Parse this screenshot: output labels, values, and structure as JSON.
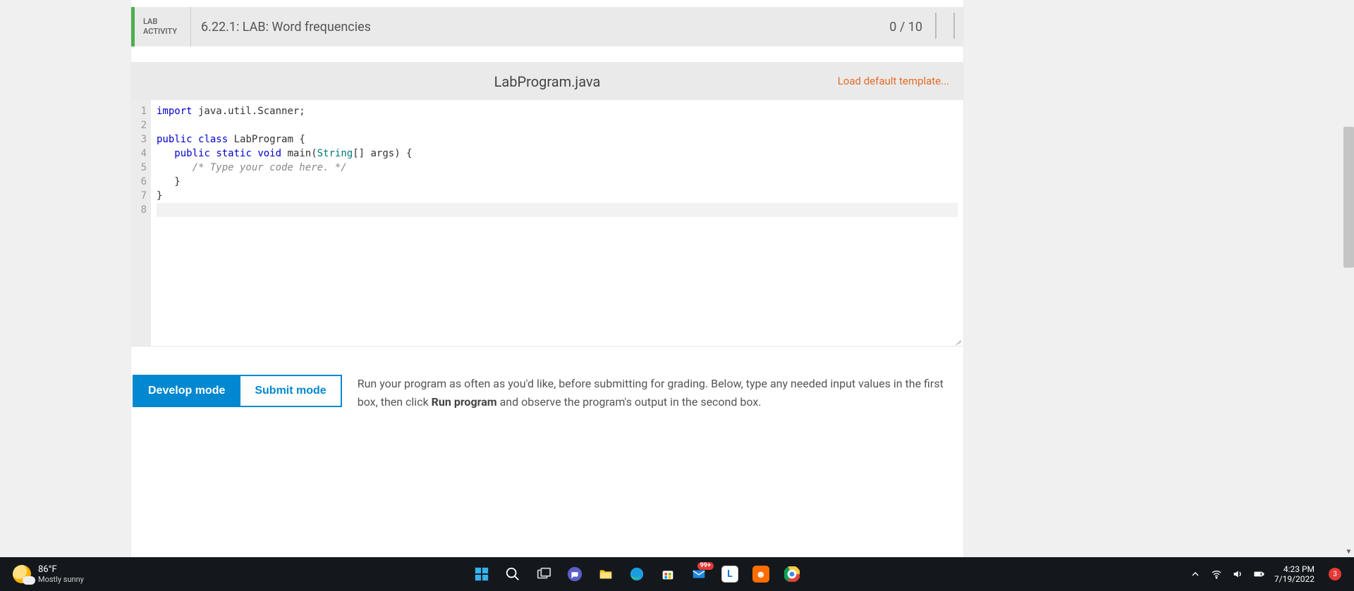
{
  "header": {
    "label_top": "LAB",
    "label_bottom": "ACTIVITY",
    "title": "6.22.1: LAB: Word frequencies",
    "score": "0 / 10"
  },
  "file": {
    "name": "LabProgram.java",
    "load_template": "Load default template..."
  },
  "code_lines": [
    {
      "n": 1,
      "html": "<span class='kw'>import</span> java.util.Scanner;"
    },
    {
      "n": 2,
      "html": ""
    },
    {
      "n": 3,
      "html": "<span class='kw'>public</span> <span class='kw'>class</span> <span class='cls'>LabProgram</span> {"
    },
    {
      "n": 4,
      "html": "   <span class='kw'>public</span> <span class='kw'>static</span> <span class='kw'>void</span> main(<span class='type'>String</span>[] args) {"
    },
    {
      "n": 5,
      "html": "      <span class='cmt'>/* Type your code here. */</span>"
    },
    {
      "n": 6,
      "html": "   }"
    },
    {
      "n": 7,
      "html": "}"
    },
    {
      "n": 8,
      "html": "",
      "hl": true
    }
  ],
  "mode": {
    "develop": "Develop mode",
    "submit": "Submit mode",
    "desc_pre": "Run your program as often as you'd like, before submitting for grading. Below, type any needed input values in the first box, then click ",
    "desc_bold": "Run program",
    "desc_post": " and observe the program's output in the second box."
  },
  "taskbar": {
    "temp": "86°F",
    "cond": "Mostly sunny",
    "mail_badge": "99+",
    "notif_count": "3",
    "time": "4:23 PM",
    "date": "7/19/2022"
  }
}
